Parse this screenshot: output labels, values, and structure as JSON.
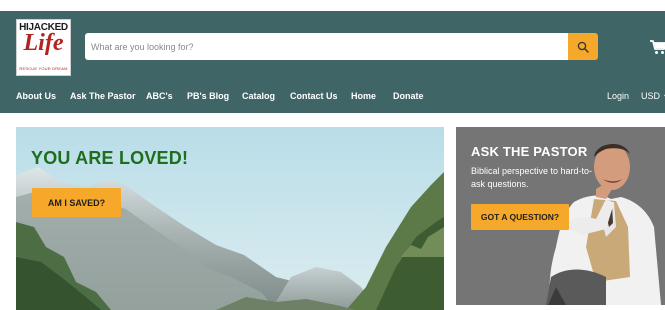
{
  "logo": {
    "top_text": "HIJACKED",
    "script_text": "Life",
    "tagline": "RESCUE YOUR DREAM"
  },
  "search": {
    "placeholder": "What are you looking for?",
    "icon": "search-icon"
  },
  "cart": {
    "icon": "cart-icon"
  },
  "nav": {
    "items": [
      {
        "label": "About Us"
      },
      {
        "label": "Ask The Pastor"
      },
      {
        "label": "ABC's"
      },
      {
        "label": "PB's Blog"
      },
      {
        "label": "Catalog"
      },
      {
        "label": "Contact Us"
      },
      {
        "label": "Home"
      },
      {
        "label": "Donate"
      }
    ],
    "login": "Login",
    "currency": "USD"
  },
  "hero": {
    "title": "YOU ARE LOVED!",
    "button": "AM I SAVED?"
  },
  "pastor_card": {
    "title": "ASK THE PASTOR",
    "description": "Biblical perspective to hard-to-ask questions.",
    "button": "GOT A QUESTION?"
  },
  "colors": {
    "header_bg": "#3f6566",
    "accent": "#f5a829",
    "hero_title": "#1d6e1d",
    "card_bg": "#757575"
  }
}
